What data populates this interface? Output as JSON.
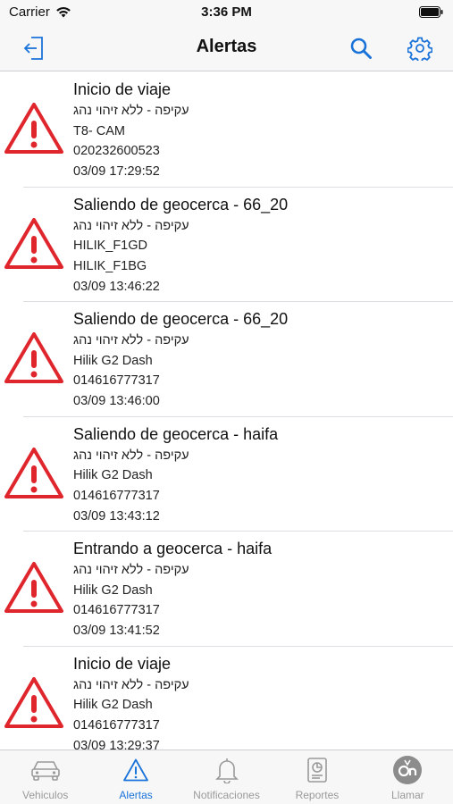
{
  "status_bar": {
    "carrier": "Carrier",
    "time": "3:36 PM"
  },
  "nav": {
    "title": "Alertas",
    "left_icon": "logout-icon",
    "right_icons": [
      "search-icon",
      "gear-icon"
    ]
  },
  "colors": {
    "accent": "#1a73d9",
    "alert_red": "#e0262d",
    "tab_inactive": "#9a9a9a"
  },
  "alerts": [
    {
      "title": "Inicio de viaje",
      "lines": [
        "עקיפה - ללא זיהוי נהג",
        "T8- CAM",
        "020232600523",
        "03/09 17:29:52"
      ]
    },
    {
      "title": "Saliendo de geocerca - 66_20",
      "lines": [
        "עקיפה - ללא זיהוי נהג",
        "HILIK_F1GD",
        "HILIK_F1BG",
        "03/09 13:46:22"
      ]
    },
    {
      "title": "Saliendo de geocerca - 66_20",
      "lines": [
        "עקיפה - ללא זיהוי נהג",
        "Hilik G2 Dash",
        "014616777317",
        "03/09 13:46:00"
      ]
    },
    {
      "title": "Saliendo de geocerca - haifa",
      "lines": [
        "עקיפה - ללא זיהוי נהג",
        "Hilik G2 Dash",
        "014616777317",
        "03/09 13:43:12"
      ]
    },
    {
      "title": "Entrando a geocerca - haifa",
      "lines": [
        "עקיפה - ללא זיהוי נהג",
        "Hilik G2 Dash",
        "014616777317",
        "03/09 13:41:52"
      ]
    },
    {
      "title": "Inicio de viaje",
      "lines": [
        "עקיפה - ללא זיהוי נהג",
        "Hilik G2 Dash",
        "014616777317",
        "03/09 13:29:37"
      ]
    }
  ],
  "tabs": [
    {
      "label": "Vehiculos",
      "icon": "car-icon",
      "active": false
    },
    {
      "label": "Alertas",
      "icon": "warning-icon",
      "active": true
    },
    {
      "label": "Notificaciones",
      "icon": "bell-icon",
      "active": false
    },
    {
      "label": "Reportes",
      "icon": "report-icon",
      "active": false
    },
    {
      "label": "Llamar",
      "icon": "call-icon",
      "active": false
    }
  ]
}
